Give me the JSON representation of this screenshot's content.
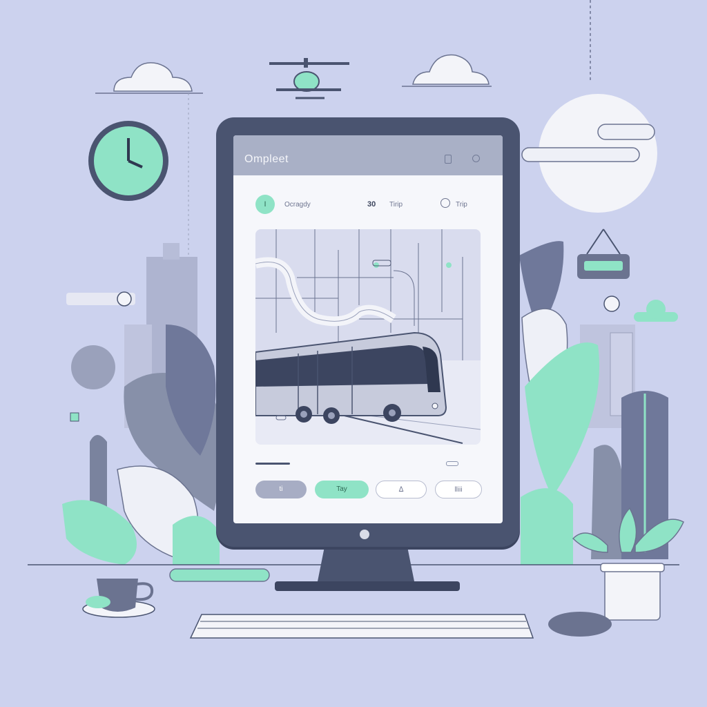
{
  "app": {
    "title": "Omplеet",
    "category": "Ocragdy",
    "count": "30",
    "trip_label": "Tirip",
    "trip_label_2": "Trip",
    "badge": "I"
  },
  "buttons": {
    "first": "ti",
    "second": "Tay",
    "third": "ᐃ",
    "fourth": "lliii"
  },
  "colors": {
    "background": "#ccd2ee",
    "device": "#4a5470",
    "accent": "#8fe3c6",
    "appbar": "#a9b0c6"
  },
  "icons": {
    "bar_left": "square-icon",
    "bar_right": "circle-icon",
    "trip": "circle-icon"
  }
}
